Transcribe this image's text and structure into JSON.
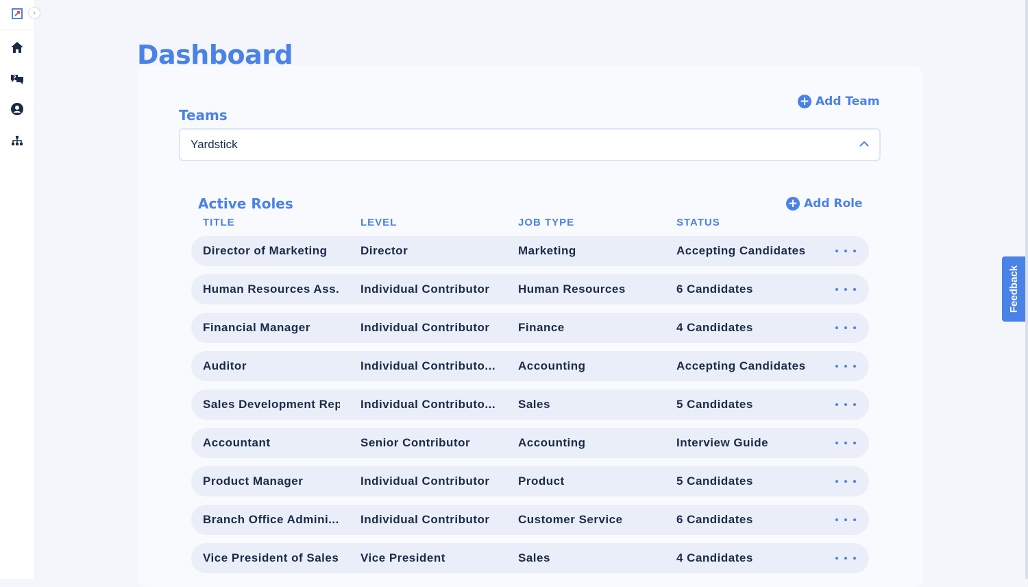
{
  "sidebar": {
    "icons": [
      "logo-icon",
      "home-icon",
      "interview-questions-icon",
      "profile-icon",
      "org-chart-icon"
    ],
    "expand_icon": "›"
  },
  "page": {
    "title": "Dashboard"
  },
  "teams": {
    "label": "Teams",
    "add_label": "Add Team",
    "selected": "Yardstick"
  },
  "roles": {
    "label": "Active Roles",
    "add_label": "Add Role",
    "columns": [
      "TITLE",
      "LEVEL",
      "JOB TYPE",
      "STATUS"
    ],
    "rows": [
      {
        "title": "Director of Marketing",
        "level": "Director",
        "job_type": "Marketing",
        "status": "Accepting Candidates"
      },
      {
        "title": "Human Resources Ass...",
        "level": "Individual Contributor",
        "job_type": "Human Resources",
        "status": "6 Candidates"
      },
      {
        "title": "Financial Manager",
        "level": "Individual Contributor",
        "job_type": "Finance",
        "status": "4 Candidates"
      },
      {
        "title": "Auditor",
        "level": "Individual Contributo...",
        "job_type": "Accounting",
        "status": "Accepting Candidates"
      },
      {
        "title": "Sales Development Rep",
        "level": "Individual Contributo...",
        "job_type": "Sales",
        "status": "5 Candidates"
      },
      {
        "title": "Accountant",
        "level": "Senior Contributor",
        "job_type": "Accounting",
        "status": "Interview Guide"
      },
      {
        "title": "Product Manager",
        "level": "Individual Contributor",
        "job_type": "Product",
        "status": "5 Candidates"
      },
      {
        "title": "Branch Office Admini...",
        "level": "Individual Contributor",
        "job_type": "Customer Service",
        "status": "6 Candidates"
      },
      {
        "title": "Vice President of Sales",
        "level": "Vice President",
        "job_type": "Sales",
        "status": "4 Candidates"
      }
    ]
  },
  "feedback": {
    "label": "Feedback"
  },
  "colors": {
    "accent": "#4a82e8",
    "text": "#1c2a4a",
    "row_bg": "#e9eef8"
  }
}
